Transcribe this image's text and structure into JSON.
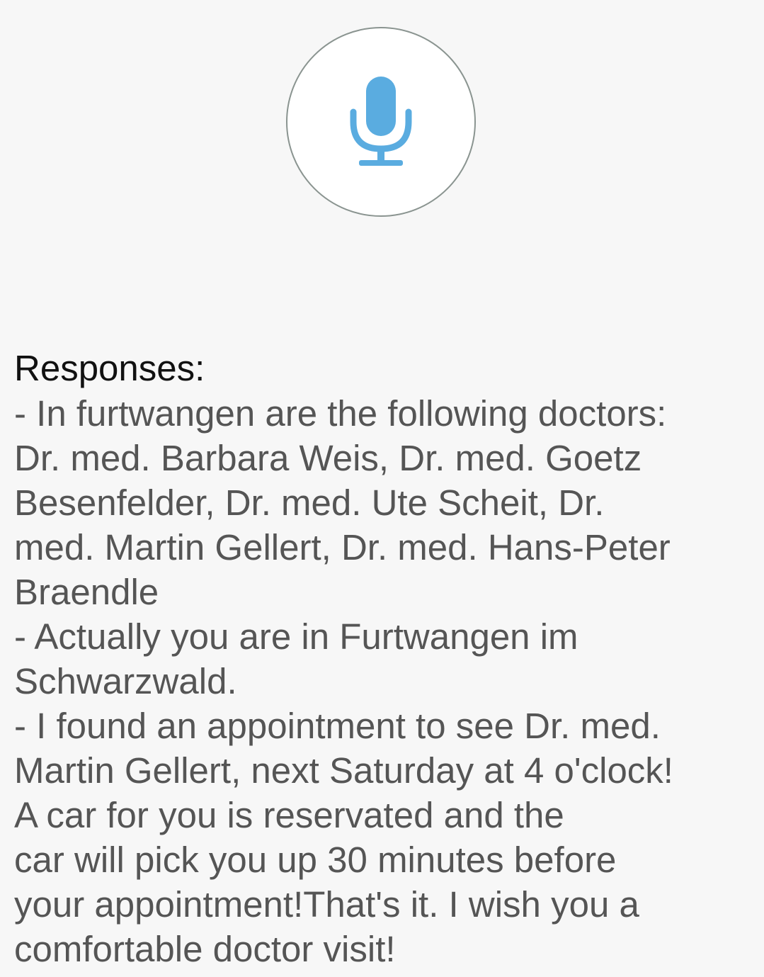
{
  "mic": {
    "icon": "microphone-icon",
    "color": "#5aace0"
  },
  "responses": {
    "heading": "Responses:",
    "text": "- In furtwangen are the following doctors:\nDr. med. Barbara Weis, Dr. med. Goetz\nBesenfelder, Dr. med. Ute Scheit, Dr.\nmed. Martin Gellert, Dr. med. Hans-Peter\nBraendle\n- Actually you are in Furtwangen im\nSchwarzwald.\n- I found an appointment to see Dr. med.\nMartin Gellert, next Saturday at 4 o'clock!\nA car for you is reservated and the\ncar will pick you up 30 minutes before\nyour appointment!That's it. I wish you a\ncomfortable doctor visit!"
  }
}
